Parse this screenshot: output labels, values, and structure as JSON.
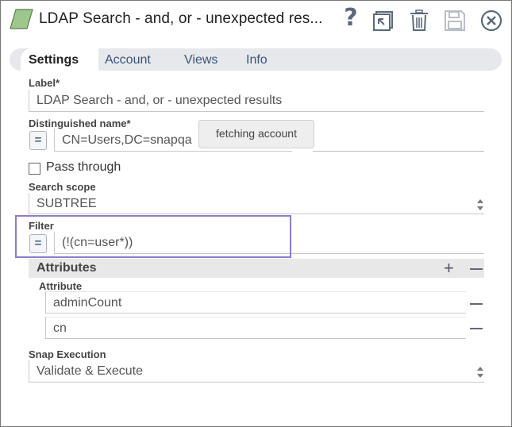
{
  "header": {
    "title": "LDAP Search - and, or - unexpected res...",
    "help_label": "?"
  },
  "tabs": [
    {
      "label": "Settings",
      "active": true
    },
    {
      "label": "Account",
      "active": false
    },
    {
      "label": "Views",
      "active": false
    },
    {
      "label": "Info",
      "active": false
    }
  ],
  "form": {
    "label": {
      "title": "Label*",
      "value": "LDAP Search - and, or - unexpected results"
    },
    "dn": {
      "title": "Distinguished name*",
      "value": "CN=Users,DC=snapqa",
      "eq": "="
    },
    "tooltip": "fetching account",
    "pass_through": {
      "label": "Pass through",
      "checked": false
    },
    "scope": {
      "title": "Search scope",
      "value": "SUBTREE"
    },
    "filter": {
      "title": "Filter",
      "value": "(!(cn=user*))",
      "eq": "="
    },
    "attributes": {
      "title": "Attributes",
      "column": "Attribute",
      "rows": [
        "adminCount",
        "cn"
      ]
    },
    "execution": {
      "title": "Snap Execution",
      "value": "Validate & Execute"
    }
  },
  "colors": {
    "highlight": "#8b7bd8",
    "tab_bar": "#e6e8ec",
    "snap_icon": "#8fbf7a"
  }
}
